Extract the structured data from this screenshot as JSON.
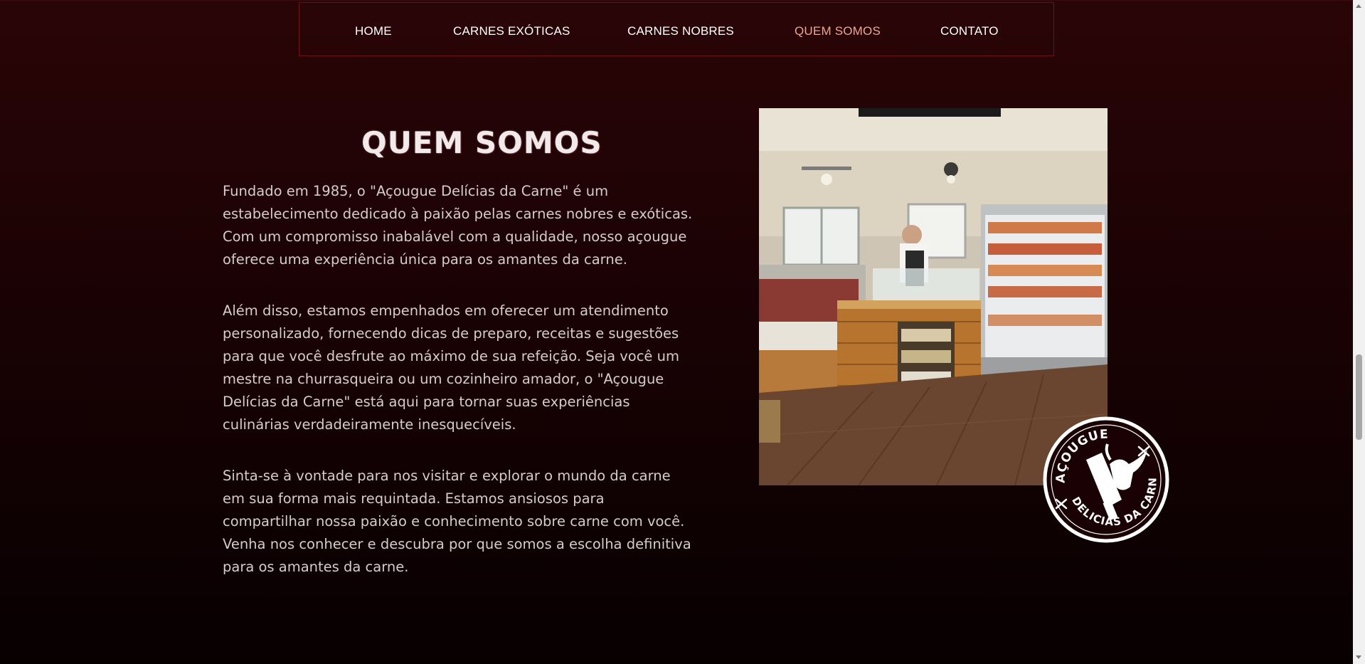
{
  "nav": {
    "items": [
      {
        "label": "HOME"
      },
      {
        "label": "CARNES EXÓTICAS"
      },
      {
        "label": "CARNES NOBRES"
      },
      {
        "label": "QUEM SOMOS"
      },
      {
        "label": "CONTATO"
      }
    ],
    "active": "QUEM SOMOS"
  },
  "about": {
    "title": "QUEM SOMOS",
    "paragraphs": [
      "Fundado em 1985, o \"Açougue Delícias da Carne\" é um estabelecimento dedicado à paixão pelas carnes nobres e exóticas. Com um compromisso inabalável com a qualidade, nosso açougue oferece uma experiência única para os amantes da carne.",
      "Além disso, estamos empenhados em oferecer um atendimento personalizado, fornecendo dicas de preparo, receitas e sugestões para que você desfrute ao máximo de sua refeição. Seja você um mestre na churrasqueira ou um cozinheiro amador, o \"Açougue Delícias da Carne\" está aqui para tornar suas experiências culinárias verdadeiramente inesquecíveis.",
      "Sinta-se à vontade para nos visitar e explorar o mundo da carne em sua forma mais requintada. Estamos ansiosos para compartilhar nossa paixão e conhecimento sobre carne com você. Venha nos conhecer e descubra por que somos a escolha definitiva para os amantes da carne."
    ]
  },
  "logo": {
    "top_text": "AÇOUGUE",
    "bottom_text": "DELICIAS DA CARNE",
    "icon": "cleaver-bull-icon"
  },
  "photo": {
    "icon": "butcher-shop-photo"
  },
  "colors": {
    "background_top": "#2a0507",
    "background_bottom": "#070001",
    "nav_border": "#6b1218",
    "nav_active": "#e9a79a",
    "text": "#d6cccc"
  }
}
